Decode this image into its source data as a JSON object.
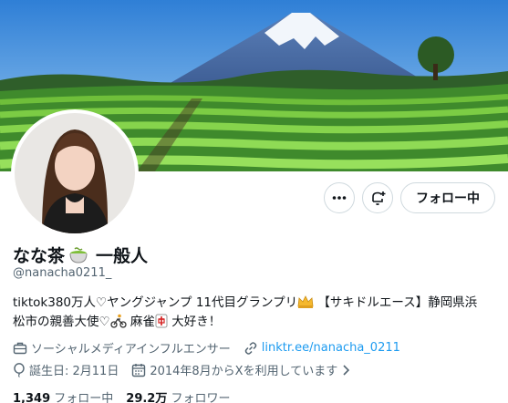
{
  "profile": {
    "display_name": "なな茶",
    "name_suffix": "一般人",
    "handle": "@nanacha0211_",
    "bio": {
      "line1_a": "tiktok380万人♡ヤングジャンプ 11代目グランプリ",
      "line1_b": "【サキドルエース】静岡県浜",
      "line2_a": "松市の親善大使♡",
      "line2_b": "麻雀",
      "line2_c": "大好き！"
    },
    "category": "ソーシャルメディアインフルエンサー",
    "link": "linktr.ee/nanacha_0211",
    "birthday": "誕生日: 2月11日",
    "joined": "2014年8月からXを利用しています",
    "following_count": "1,349",
    "following_label": "フォロー中",
    "followers_count": "29.2万",
    "followers_label": "フォロワー"
  },
  "actions": {
    "follow_label": "フォロー中",
    "more_icon": "more-icon",
    "notify_icon": "bell-plus-icon"
  },
  "colors": {
    "accent": "#1d9bf0",
    "text": "#0f1419",
    "muted": "#536471",
    "border": "#cfd9de"
  }
}
